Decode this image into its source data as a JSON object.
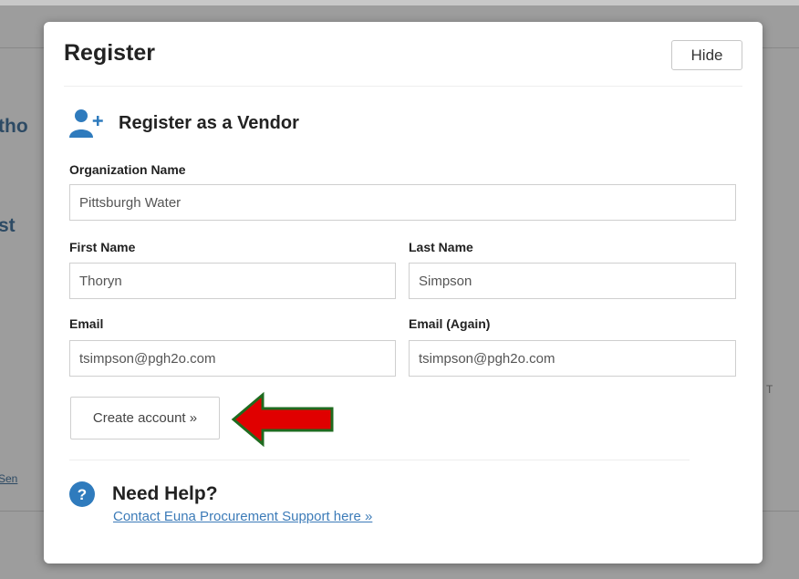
{
  "background": {
    "fragment_1": "tho",
    "fragment_2": "st",
    "fragment_3": "T",
    "fragment_4": "Sen"
  },
  "modal": {
    "title": "Register",
    "hide_label": "Hide"
  },
  "section": {
    "icon": "user-plus-icon",
    "title": "Register as a Vendor"
  },
  "form": {
    "organization_label": "Organization Name",
    "organization_value": "Pittsburgh Water",
    "first_name_label": "First Name",
    "first_name_value": "Thoryn",
    "last_name_label": "Last Name",
    "last_name_value": "Simpson",
    "email_label": "Email",
    "email_value": "tsimpson@pgh2o.com",
    "email_again_label": "Email (Again)",
    "email_again_value": "tsimpson@pgh2o.com",
    "submit_label": "Create account »"
  },
  "annotation": {
    "arrow_fill": "#e00000",
    "arrow_stroke": "#1f6b1f"
  },
  "help": {
    "icon": "question-circle-icon",
    "title": "Need Help?",
    "link_text": "Contact Euna Procurement Support here »"
  },
  "colors": {
    "accent_blue": "#2f7bbd",
    "link_blue": "#3c7bb8"
  }
}
